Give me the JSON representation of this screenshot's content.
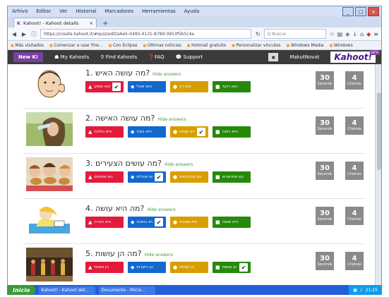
{
  "menu": [
    "Arhivo",
    "Editar",
    "Ver",
    "Historial",
    "Marcadores",
    "Herramientas",
    "Ayuda"
  ],
  "tab": {
    "title": "Kahoot! - Kahoot details",
    "close": "×",
    "new": "+"
  },
  "nav": {
    "url": "https://create.kahoot.it/#quiz/edit/a6e5-0495-4131-8789-0953f5b5c4a",
    "search_placeholder": "Q Buscar"
  },
  "bookmarks": [
    "Más visitados",
    "Comenzar a usar Fire...",
    "Con Eclipse",
    "Últimas noticias",
    "Hotmail gratuito",
    "Personalizar vínculos",
    "Windows Media",
    "Windows"
  ],
  "app": {
    "new_label": "New K!",
    "my_kahoots": "My Kahoots",
    "find_kahoots": "Find Kahoots",
    "faq": "FAQ",
    "support": "Support",
    "user": "MakutNovot",
    "logo": "Kahoot!",
    "beta": "BETA"
  },
  "questions": [
    {
      "num": "1.",
      "title": "מה עושה האיש?",
      "hide": "Hide answers",
      "answers": [
        "הוא שומע",
        "הוא אוכל",
        "הוא רץ",
        "הוא רוקד"
      ],
      "correct": 0,
      "seconds": "30",
      "seconds_label": "Seconds",
      "choices": "4",
      "choices_label": "Choices"
    },
    {
      "num": "2.",
      "title": "מה עושה האישה?",
      "hide": "Hide answers",
      "answers": [
        "היא הולכת",
        "היא בוכה",
        "היא שותה",
        "היא רואה"
      ],
      "correct": 2,
      "seconds": "30",
      "seconds_label": "Seconds",
      "choices": "4",
      "choices_label": "Choices"
    },
    {
      "num": "3.",
      "title": "מה עושים הצעירים?",
      "hide": "Hide answers",
      "answers": [
        "הם שומעים",
        "הם אוכלים",
        "הם מתלבשים",
        "הם מתיישבים"
      ],
      "correct": 1,
      "seconds": "30",
      "seconds_label": "Seconds",
      "choices": "4",
      "choices_label": "Choices"
    },
    {
      "num": "4.",
      "title": "מה היא עושה?",
      "hide": "Hide answers",
      "answers": [
        "היא חוזרת",
        "היא כותבת",
        "היא שוכבת",
        "היא שותה"
      ],
      "correct": 1,
      "seconds": "30",
      "seconds_label": "Seconds",
      "choices": "4",
      "choices_label": "Choices"
    },
    {
      "num": "5.",
      "title": "מה הן עושות?",
      "hide": "Hide answers",
      "answers": [
        "הן טוסות",
        "הן רוקדות",
        "הן שותות",
        "הן עושות"
      ],
      "correct": 3,
      "seconds": "30",
      "seconds_label": "Seconds",
      "choices": "4",
      "choices_label": "Choices"
    }
  ],
  "taskbar": {
    "start": "Inicio",
    "tasks": [
      "Kahoot! - Kahoot det...",
      "Documento - Micro..."
    ],
    "clock": "21:25"
  },
  "colors": {
    "red": "#e21b3c",
    "blue": "#1368ce",
    "yellow": "#d89e00",
    "green": "#26890c"
  },
  "shapes": [
    "triangle-icon",
    "diamond-icon",
    "circle-icon",
    "square-icon"
  ]
}
